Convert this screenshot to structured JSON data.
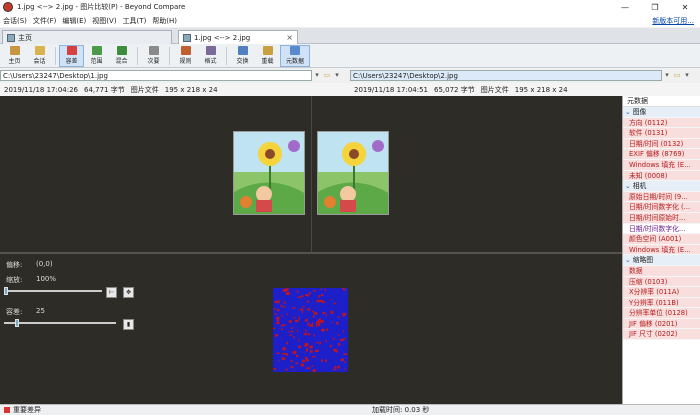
{
  "window": {
    "title": "1.jpg <--> 2.jpg - 图片比较(P) - Beyond Compare",
    "controls": [
      "—",
      "❐",
      "✕"
    ]
  },
  "menu": {
    "items": [
      "会话(S)",
      "文件(F)",
      "编辑(E)",
      "视图(V)",
      "工具(T)",
      "帮助(H)"
    ],
    "update_link": "新版本可用..."
  },
  "tabs": {
    "home": "主页",
    "compare": "1.jpg <--> 2.jpg"
  },
  "toolbar": {
    "home": "主页",
    "session": "会话",
    "diffs": "容差",
    "range": "范围",
    "blend": "混合",
    "next": "次要",
    "rules": "规则",
    "format": "格式",
    "swap": "交换",
    "reload": "重载",
    "metadata": "元数据"
  },
  "left": {
    "path": "C:\\Users\\23247\\Desktop\\1.jpg",
    "date": "2019/11/18 17:04:26",
    "size": "64,771 字节",
    "type": "图片文件",
    "dims": "195 x 218 x 24"
  },
  "right": {
    "path": "C:\\Users\\23247\\Desktop\\2.jpg",
    "date": "2019/11/18 17:04:51",
    "size": "65,072 字节",
    "type": "图片文件",
    "dims": "195 x 218 x 24"
  },
  "controls": {
    "offset_label": "偏移:",
    "offset_value": "(0,0)",
    "zoom_label": "缩放:",
    "zoom_value": "100%",
    "zoom_level": 0.0,
    "tolerance_label": "容差:",
    "tolerance_value": "25",
    "tolerance_level": 0.05
  },
  "metadata_panel": {
    "title": "元数据",
    "groups": [
      {
        "name": "图像",
        "rows": [
          {
            "text": "方向 (0112)",
            "diff": true
          },
          {
            "text": "软件 (0131)",
            "diff": true
          },
          {
            "text": "日期/时间 (0132)",
            "diff": true
          },
          {
            "text": "EXIF 偏移 (8769)",
            "diff": true
          },
          {
            "text": "Windows 填充 (E...",
            "diff": true
          },
          {
            "text": "未知 (0008)",
            "diff": true
          }
        ]
      },
      {
        "name": "相机",
        "rows": [
          {
            "text": "原始日期/时间 (9...",
            "diff": true
          },
          {
            "text": "日期/时间数字化 (...",
            "diff": true
          },
          {
            "text": "日期/时间原始时...",
            "diff": true
          },
          {
            "text": "日期/时间数字化...",
            "diff": false
          },
          {
            "text": "颜色空间 (A001)",
            "diff": true
          },
          {
            "text": "Windows 填充 (E...",
            "diff": true
          }
        ]
      },
      {
        "name": "缩略图",
        "rows": [
          {
            "text": "数据",
            "diff": true
          },
          {
            "text": "压缩 (0103)",
            "diff": true
          },
          {
            "text": "X分辨率 (011A)",
            "diff": true
          },
          {
            "text": "Y分辨率 (011B)",
            "diff": true
          },
          {
            "text": "分辨率单位 (0128)",
            "diff": true
          },
          {
            "text": "JIF 偏移 (0201)",
            "diff": true
          },
          {
            "text": "JIF 尺寸 (0202)",
            "diff": true
          }
        ]
      }
    ]
  },
  "status": {
    "left": "重要差异",
    "load_time": "加载时间: 0.03 秒"
  },
  "colors": {
    "canvas": "#2e2c26",
    "diff_text": "#b31c1c",
    "diff_bg": "#f9dede",
    "diff_blue": "#1d1fc8",
    "diff_red": "#c3141c"
  }
}
